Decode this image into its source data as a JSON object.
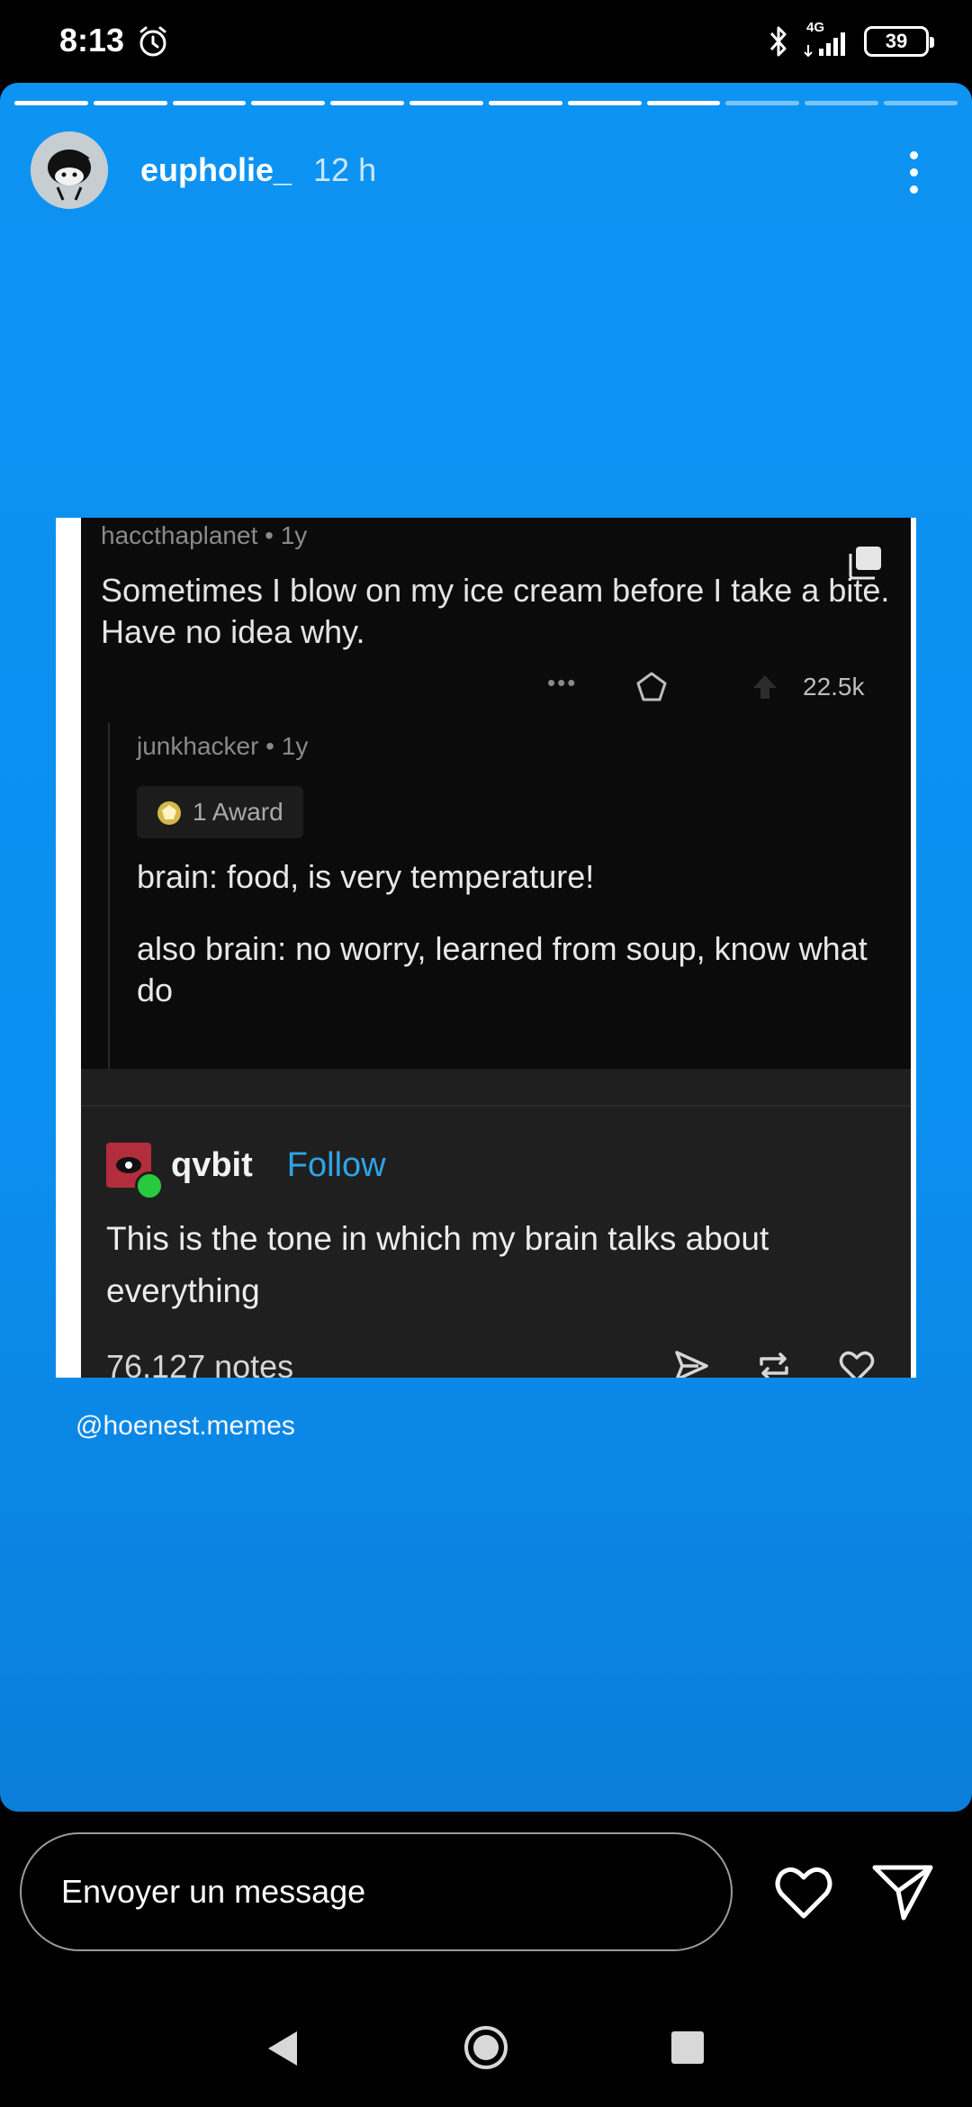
{
  "status_bar": {
    "time": "8:13",
    "network": "4G",
    "battery": "39",
    "icons": [
      "alarm-icon",
      "bluetooth-icon",
      "signal-icon",
      "battery-icon"
    ]
  },
  "story": {
    "segments_total": 12,
    "segments_done": 9,
    "username": "eupholie_",
    "time_ago": "12 h",
    "background_color": "#0d93f2",
    "credit": "@hoenest.memes"
  },
  "post": {
    "reddit": {
      "op_meta": "haccthaplanet • 1y",
      "op_text": "Sometimes I blow on my ice cream before I take a bite. Have no idea why.",
      "dots": "•••",
      "score": "22.5k",
      "reply_meta": "junkhacker • 1y",
      "award_label": "1 Award",
      "reply_line1": "brain: food, is very temperature!",
      "reply_line2": "also brain: no worry, learned from soup, know what do"
    },
    "tumblr": {
      "username": "qvbit",
      "follow_label": "Follow",
      "text": "This is the tone in which my brain talks about everything",
      "notes": "76,127 notes",
      "accent": "#2fa4e7"
    }
  },
  "message_bar": {
    "placeholder": "Envoyer un message"
  }
}
